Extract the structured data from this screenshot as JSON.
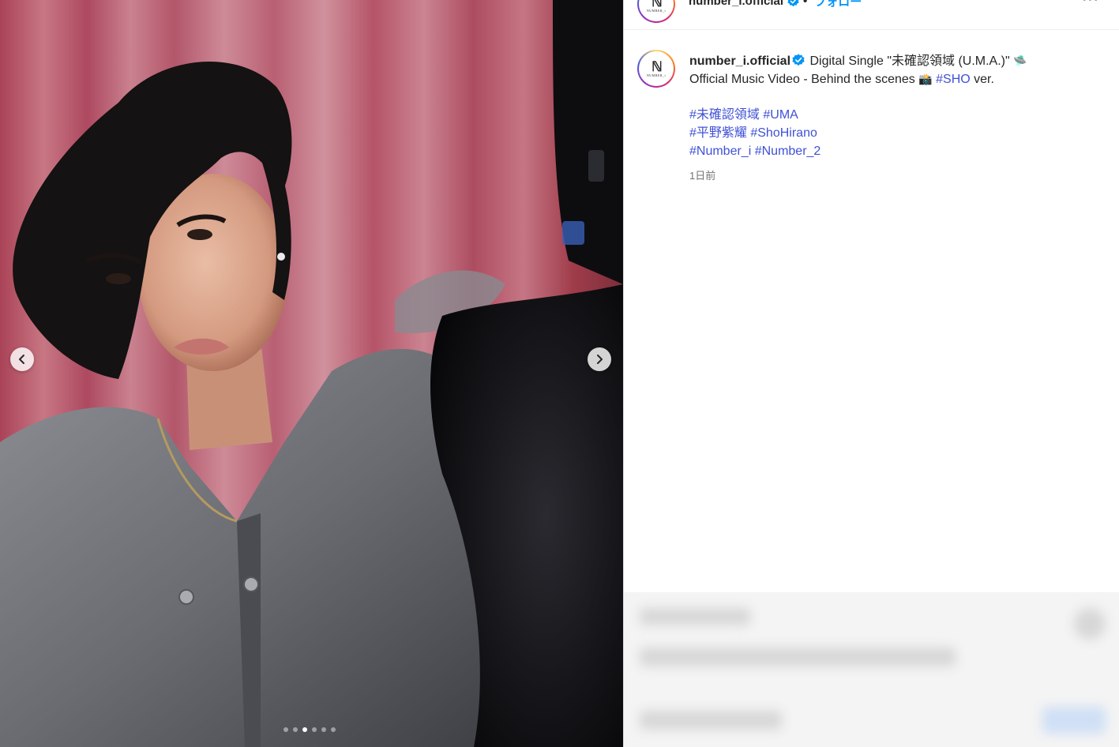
{
  "post": {
    "username": "number_i.official",
    "follow_label": "フォロー",
    "more_label": "•••",
    "avatar_mark": "ℕ",
    "avatar_sub": "NUMBER_i",
    "caption_text_1": "Digital Single \"未確認領域 (U.M.A.)\"",
    "caption_text_2": "Official Music Video - Behind the scenes",
    "caption_tag_inline": "#SHO",
    "caption_text_3": "ver.",
    "hashtags_line1": [
      "#未確認領域",
      "#UMA"
    ],
    "hashtags_line2": [
      "#平野紫耀",
      "#ShoHirano"
    ],
    "hashtags_line3": [
      "#Number_i",
      "#Number_2"
    ],
    "timestamp": "1日前"
  },
  "carousel": {
    "slide_count": 6,
    "active_index": 2
  },
  "icons": {
    "verified": "verified-badge-icon",
    "ufo": "ufo-emoji-icon",
    "camera": "camera-flash-emoji-icon",
    "prev": "chevron-left-icon",
    "next": "chevron-right-icon"
  },
  "colors": {
    "link": "#3f51d6",
    "verified": "#0095f6",
    "text": "#262626",
    "muted": "#737373"
  }
}
